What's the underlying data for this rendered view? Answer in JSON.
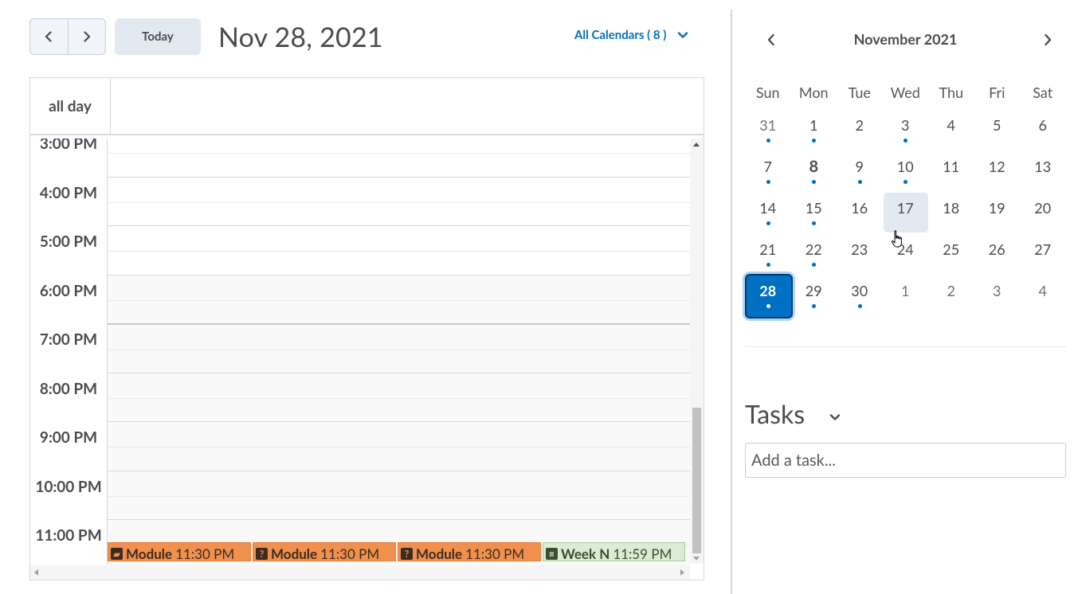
{
  "toolbar": {
    "prev_icon": "chevron-left-icon",
    "next_icon": "chevron-right-icon",
    "today_label": "Today",
    "current_date": "Nov 28, 2021",
    "all_calendars_label": "All Calendars ( 8 )",
    "dropdown_icon": "chevron-down-icon"
  },
  "day_view": {
    "allday_label": "all day",
    "hours": [
      "3:00 PM",
      "4:00 PM",
      "5:00 PM",
      "6:00 PM",
      "7:00 PM",
      "8:00 PM",
      "9:00 PM",
      "10:00 PM",
      "11:00 PM"
    ],
    "events": [
      {
        "title": "Module",
        "time": "11:30 PM",
        "icon": "module-icon",
        "color": "#f0904d"
      },
      {
        "title": "Module",
        "time": "11:30 PM",
        "icon": "quiz-icon",
        "color": "#f0904d"
      },
      {
        "title": "Module",
        "time": "11:30 PM",
        "icon": "quiz-icon",
        "color": "#f0904d"
      },
      {
        "title": "Week N",
        "time": "11:59 PM",
        "icon": "document-icon",
        "color": "#d9ecd4"
      }
    ]
  },
  "mini_calendar": {
    "title": "November 2021",
    "weekdays": [
      "Sun",
      "Mon",
      "Tue",
      "Wed",
      "Thu",
      "Fri",
      "Sat"
    ],
    "weeks": [
      [
        {
          "d": "31",
          "other": true,
          "dot": true
        },
        {
          "d": "1",
          "dot": true
        },
        {
          "d": "2"
        },
        {
          "d": "3",
          "dot": true
        },
        {
          "d": "4"
        },
        {
          "d": "5"
        },
        {
          "d": "6"
        }
      ],
      [
        {
          "d": "7",
          "dot": true
        },
        {
          "d": "8",
          "dot": true,
          "bold": true
        },
        {
          "d": "9",
          "dot": true
        },
        {
          "d": "10",
          "dot": true
        },
        {
          "d": "11"
        },
        {
          "d": "12"
        },
        {
          "d": "13"
        }
      ],
      [
        {
          "d": "14",
          "dot": true
        },
        {
          "d": "15",
          "dot": true
        },
        {
          "d": "16"
        },
        {
          "d": "17",
          "hover": true
        },
        {
          "d": "18"
        },
        {
          "d": "19"
        },
        {
          "d": "20"
        }
      ],
      [
        {
          "d": "21",
          "dot": true
        },
        {
          "d": "22",
          "dot": true
        },
        {
          "d": "23"
        },
        {
          "d": "24"
        },
        {
          "d": "25"
        },
        {
          "d": "26"
        },
        {
          "d": "27"
        }
      ],
      [
        {
          "d": "28",
          "dot": true,
          "selected": true
        },
        {
          "d": "29",
          "dot": true
        },
        {
          "d": "30",
          "dot": true
        },
        {
          "d": "1",
          "other": true
        },
        {
          "d": "2",
          "other": true
        },
        {
          "d": "3",
          "other": true
        },
        {
          "d": "4",
          "other": true
        }
      ]
    ]
  },
  "tasks": {
    "title": "Tasks",
    "toggle_icon": "chevron-down-icon",
    "input_placeholder": "Add a task..."
  },
  "colors": {
    "accent": "#006fbf",
    "selected_day": "#0070c5",
    "event_orange": "#f0904d",
    "event_green": "#d9ecd4"
  }
}
